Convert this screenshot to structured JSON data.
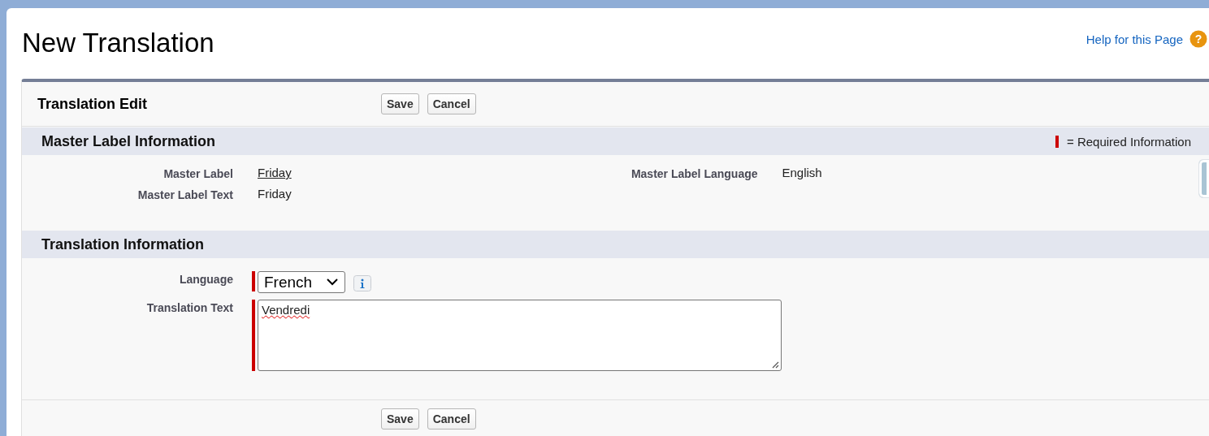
{
  "page": {
    "title": "New Translation",
    "help_link": "Help for this Page",
    "help_icon": "?"
  },
  "panel": {
    "title": "Translation Edit",
    "top_buttons": [
      "Save",
      "Cancel"
    ],
    "bottom_buttons": [
      "Save",
      "Cancel"
    ]
  },
  "master_section": {
    "title": "Master Label Information",
    "legend": "= Required Information",
    "left_fields": [
      {
        "label": "Master Label",
        "value": "Friday",
        "kind": "link"
      },
      {
        "label": "Master Label Text",
        "value": "Friday",
        "kind": "text"
      }
    ],
    "right_fields": [
      {
        "label": "Master Label Language",
        "value": "English",
        "kind": "text"
      }
    ]
  },
  "translation_section": {
    "title": "Translation Information",
    "fields": [
      {
        "label": "Language",
        "value": "French",
        "kind": "select",
        "required": true
      },
      {
        "label": "Translation Text",
        "value": "Vendredi",
        "kind": "textarea",
        "required": true
      }
    ]
  }
}
